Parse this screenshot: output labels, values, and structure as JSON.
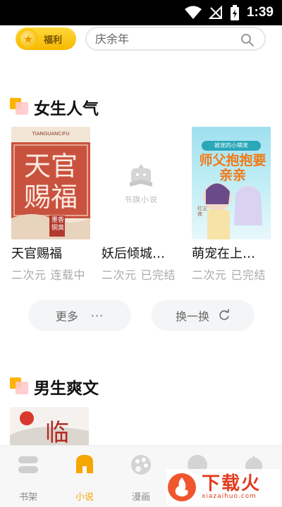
{
  "status_bar": {
    "time": "1:39",
    "icons": [
      "wifi-icon",
      "no-signal-icon",
      "battery-icon"
    ]
  },
  "header": {
    "fuli_label": "福利",
    "search_placeholder": "庆余年"
  },
  "sections": [
    {
      "title": "女生人气",
      "books": [
        {
          "title": "天官赐福",
          "category": "二次元",
          "status": "连载中",
          "cover_text": "天官赐福",
          "cover_top_text": "TIANGUANCIFU",
          "author": "墨香铜臭"
        },
        {
          "title": "妖后倾城…",
          "category": "二次元",
          "status": "已完结",
          "cover_text": "书旗小说"
        },
        {
          "title": "萌宠在上…",
          "category": "二次元",
          "status": "已完结",
          "cover_text": "师父抱抱要亲亲",
          "cover_top_text": "被宠的小萌宠",
          "cover_author": "红尘夜"
        }
      ],
      "more_label": "更多",
      "more_dots": "···",
      "swap_label": "换一换"
    },
    {
      "title": "男生爽文",
      "books": [
        {
          "cover_text": "临"
        }
      ]
    }
  ],
  "bottom_nav": [
    {
      "label": "书架",
      "icon": "bookshelf-icon",
      "active": false
    },
    {
      "label": "小说",
      "icon": "novel-icon",
      "active": true
    },
    {
      "label": "漫画",
      "icon": "comic-icon",
      "active": false
    },
    {
      "label": "",
      "icon": "audio-icon",
      "active": false
    },
    {
      "label": "",
      "icon": "profile-icon",
      "active": false
    }
  ],
  "watermark": {
    "text": "下载火",
    "sub": "xiazaihuo.com"
  },
  "colors": {
    "accent": "#f5a600",
    "meta_gray": "#aaaaaa",
    "button_bg": "#f4f5f7"
  }
}
